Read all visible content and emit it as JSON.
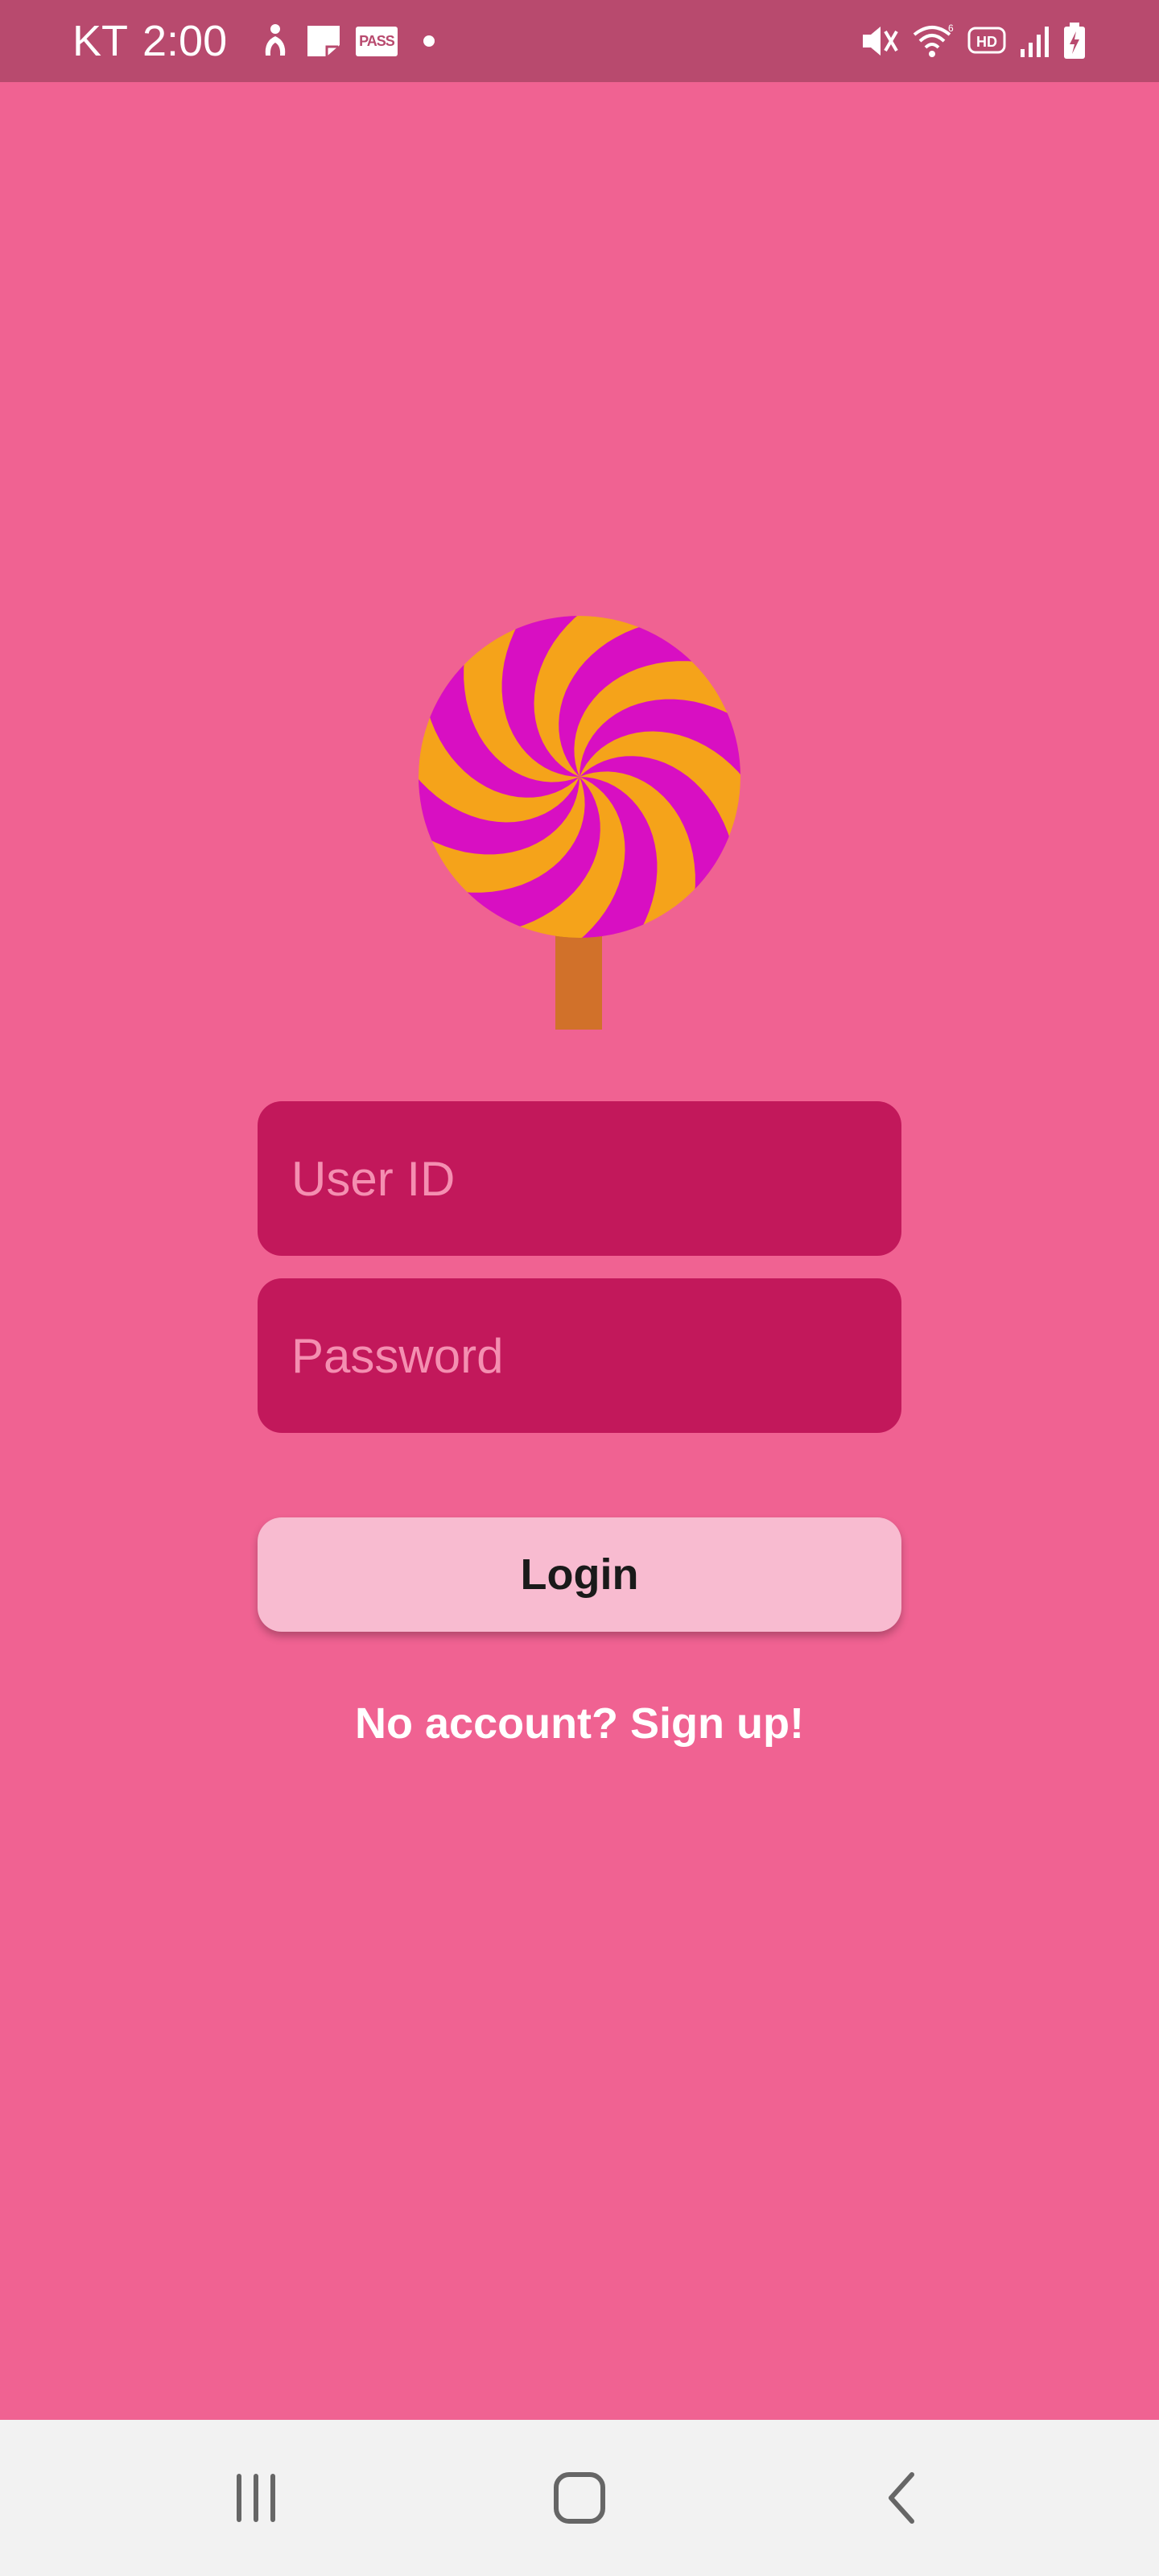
{
  "status_bar": {
    "carrier": "KT",
    "time": "2:00",
    "left_icons": [
      "accessibility-icon",
      "sticky-note-icon",
      "pass-icon",
      "notification-dot-icon"
    ],
    "pass_label": "PASS",
    "right_icons": [
      "mute-vibrate-icon",
      "wifi-icon",
      "hd-icon",
      "signal-icon",
      "battery-charging-icon"
    ],
    "wifi_tag": "6",
    "hd_label": "HD"
  },
  "logo": {
    "icon": "lollipop-icon",
    "colors": {
      "pink": "#d80fc2",
      "orange": "#f5a31a",
      "stick": "#d1712a"
    }
  },
  "form": {
    "userid_placeholder": "User ID",
    "password_placeholder": "Password",
    "login_label": "Login",
    "signup_link": "No account? Sign up!"
  },
  "nav_bar": {
    "icons": [
      "recent-apps-icon",
      "home-icon",
      "back-icon"
    ]
  },
  "colors": {
    "background": "#f06292",
    "status_bar": "#b84a6e",
    "field": "#c2185b",
    "button": "#f8bbd0"
  }
}
